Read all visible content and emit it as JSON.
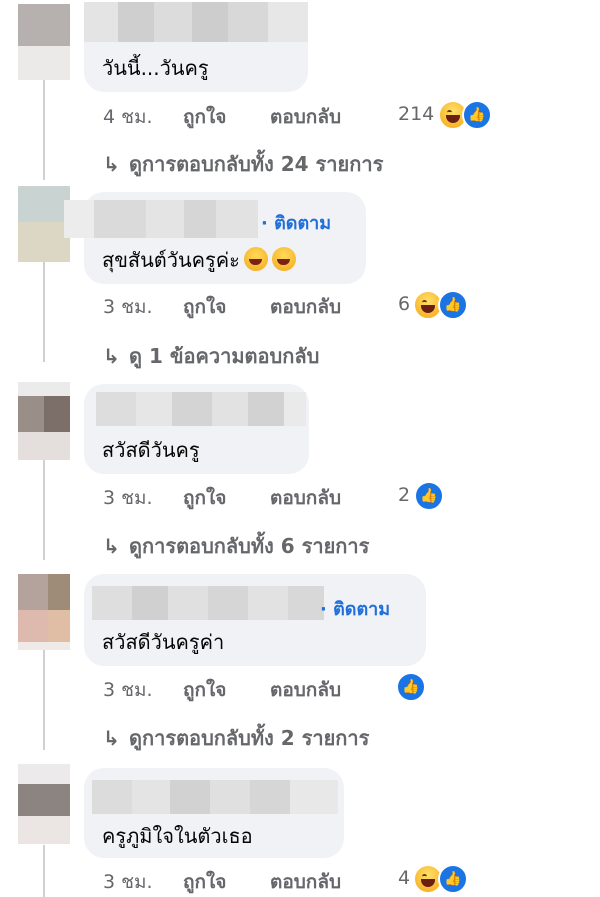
{
  "follow_label": "· ติดตาม",
  "actions": {
    "like": "ถูกใจ",
    "reply": "ตอบกลับ"
  },
  "colors": {
    "accent": "#216fdb",
    "bubble": "#f0f2f5",
    "meta": "#65676b",
    "like_blue": "#1b74e4"
  },
  "comments": [
    {
      "text": "วันนี้...วันครู",
      "time": "4 ชม.",
      "reactions": [
        "haha-icon",
        "like-icon"
      ],
      "reaction_count": "214",
      "replies_link": "ดูการตอบกลับทั้ง 24 รายการ"
    },
    {
      "text": "สุขสันต์วันครูค่ะ",
      "emojis": [
        "rofl-emoji",
        "rofl-emoji"
      ],
      "time": "3 ชม.",
      "reactions": [
        "haha-icon",
        "like-icon"
      ],
      "reaction_count": "6",
      "replies_link": "ดู 1 ข้อความตอบกลับ"
    },
    {
      "text": "สวัสดีวันครู",
      "time": "3 ชม.",
      "reactions": [
        "like-icon"
      ],
      "reaction_count": "2",
      "replies_link": "ดูการตอบกลับทั้ง 6 รายการ"
    },
    {
      "text": "สวัสดีวันครูค่า",
      "time": "3 ชม.",
      "reactions": [
        "like-icon"
      ],
      "reaction_count": "",
      "replies_link": "ดูการตอบกลับทั้ง 2 รายการ"
    },
    {
      "text": "ครูภูมิใจในตัวเธอ",
      "time": "3 ชม.",
      "reactions": [
        "haha-icon",
        "like-icon"
      ],
      "reaction_count": "4",
      "replies_link": ""
    }
  ]
}
